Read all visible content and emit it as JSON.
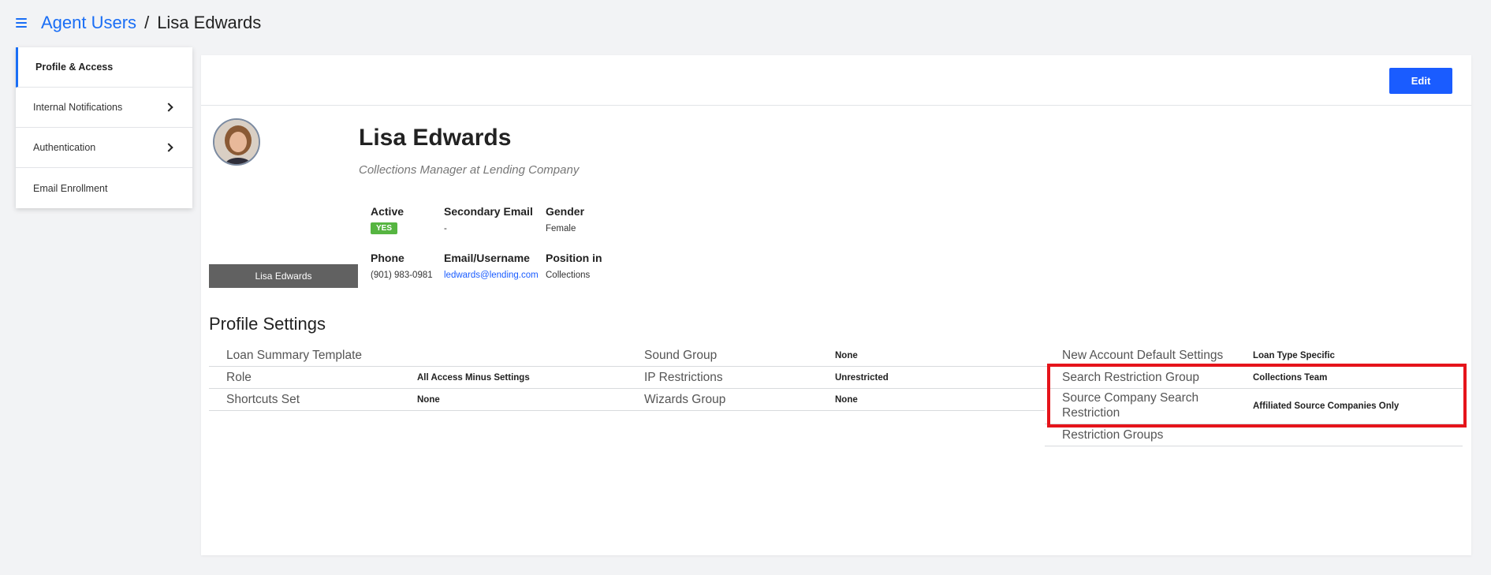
{
  "breadcrumb": {
    "parent": "Agent Users",
    "separator": "/",
    "current": "Lisa Edwards"
  },
  "sidenav": {
    "items": [
      {
        "label": "Profile & Access",
        "active": true,
        "has_chevron": false
      },
      {
        "label": "Internal Notifications",
        "active": false,
        "has_chevron": true
      },
      {
        "label": "Authentication",
        "active": false,
        "has_chevron": true
      },
      {
        "label": "Email Enrollment",
        "active": false,
        "has_chevron": false
      }
    ]
  },
  "toolbar": {
    "edit_label": "Edit"
  },
  "profile": {
    "name": "Lisa Edwards",
    "title": "Collections Manager at Lending Company",
    "name_plate": "Lisa Edwards",
    "active_label": "Active",
    "active_value": "YES",
    "secondary_email_label": "Secondary Email",
    "secondary_email_value": "-",
    "gender_label": "Gender",
    "gender_value": "Female",
    "phone_label": "Phone",
    "phone_value": "(901) 983-0981",
    "email_label": "Email/Username",
    "email_value": "ledwards@lending.com",
    "position_label": "Position in",
    "position_value": "Collections"
  },
  "settings": {
    "title": "Profile Settings",
    "col1": [
      {
        "label": "Loan Summary Template",
        "value": ""
      },
      {
        "label": "Role",
        "value": "All Access Minus Settings"
      },
      {
        "label": "Shortcuts Set",
        "value": "None"
      }
    ],
    "col2": [
      {
        "label": "Sound Group",
        "value": "None"
      },
      {
        "label": "IP Restrictions",
        "value": "Unrestricted"
      },
      {
        "label": "Wizards Group",
        "value": "None"
      }
    ],
    "col3": [
      {
        "label": "New Account Default Settings",
        "value": "Loan Type Specific"
      },
      {
        "label": "Search Restriction Group",
        "value": "Collections Team"
      },
      {
        "label": "Source Company Search Restriction",
        "value": "Affiliated Source Companies Only"
      },
      {
        "label": "Restriction Groups",
        "value": ""
      }
    ]
  },
  "colors": {
    "accent": "#1a5cff",
    "active_badge": "#56b541",
    "highlight": "#e5141b",
    "name_plate_bg": "#616161"
  }
}
